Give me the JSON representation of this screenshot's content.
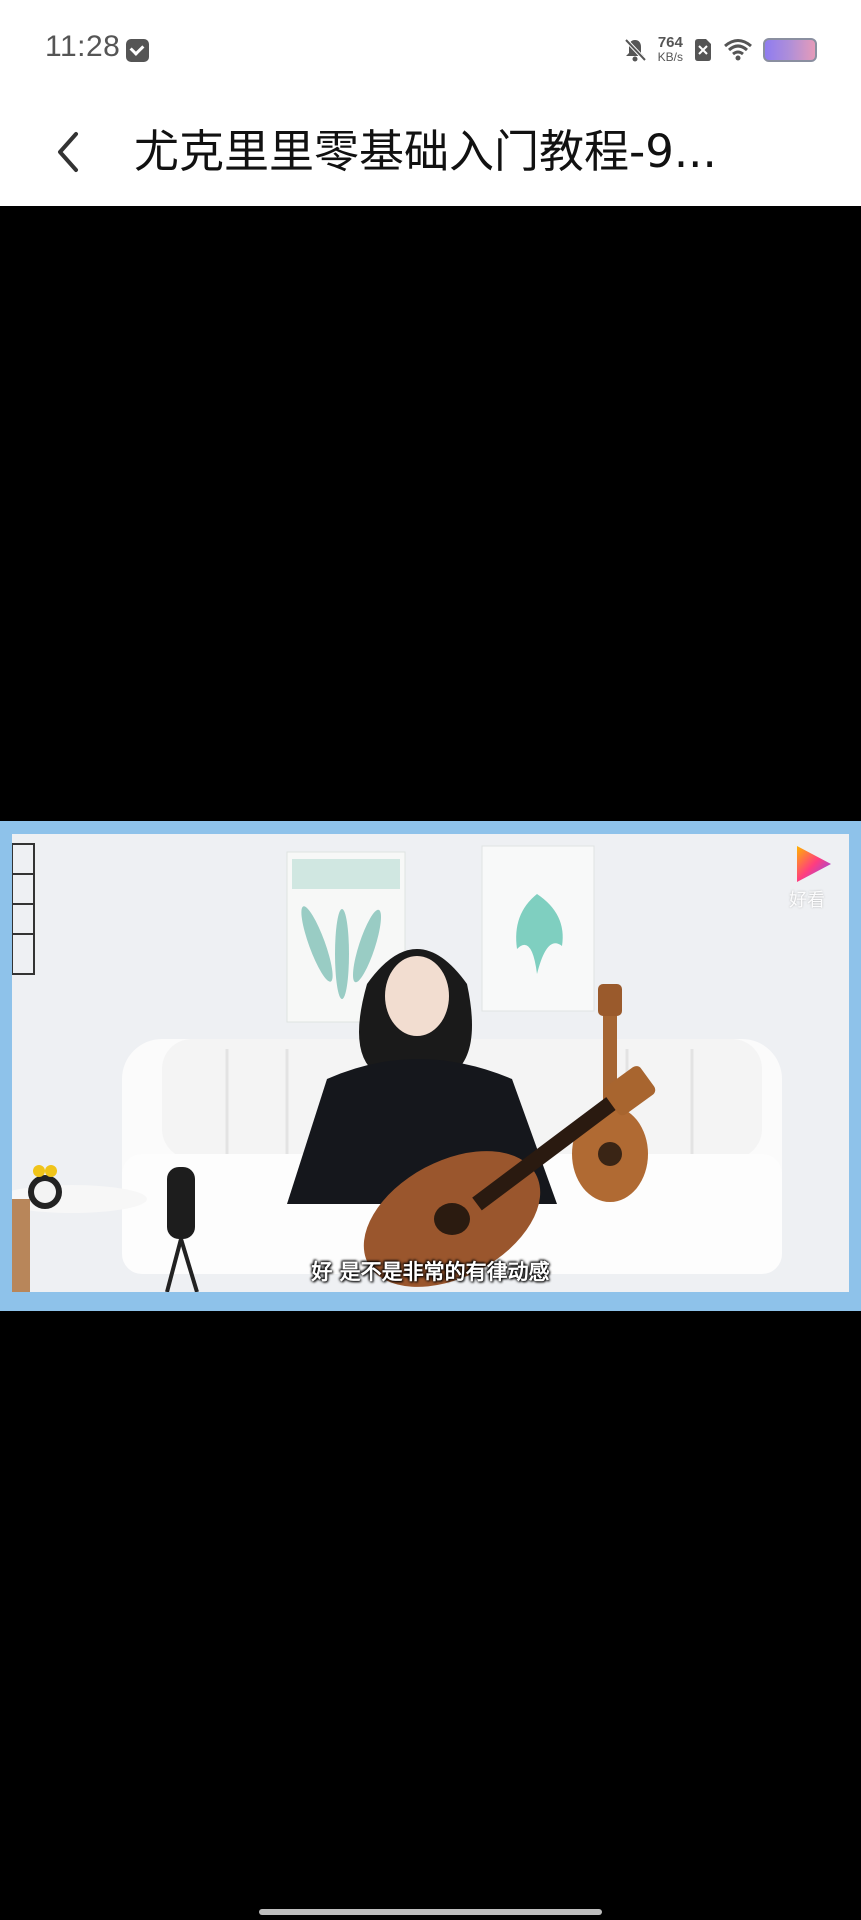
{
  "status_bar": {
    "time": "11:28",
    "network_speed_value": "764",
    "network_speed_unit": "KB/s",
    "icons": [
      "mail-icon",
      "mute-icon",
      "sim-off-icon",
      "wifi-icon",
      "battery-icon"
    ]
  },
  "header": {
    "title": "尤克里里零基础入门教程-9..."
  },
  "video": {
    "subtitle": "好 是不是非常的有律动感",
    "watermark_label": "好看"
  },
  "colors": {
    "frame_border": "#8ec2ea",
    "background": "#000000",
    "header_bg": "#ffffff"
  }
}
